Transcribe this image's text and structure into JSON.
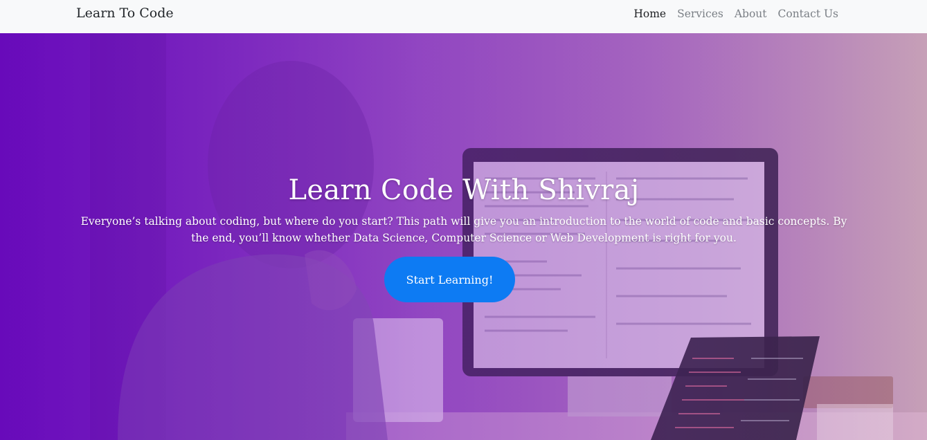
{
  "navbar": {
    "brand": "Learn To Code",
    "links": [
      {
        "label": "Home",
        "active": true
      },
      {
        "label": "Services",
        "active": false
      },
      {
        "label": "About",
        "active": false
      },
      {
        "label": "Contact Us",
        "active": false
      }
    ]
  },
  "hero": {
    "title": "Learn Code With Shivraj",
    "description": "Everyone’s talking about coding, but where do you start? This path will give you an introduction to the world of code and basic concepts. By the end, you’ll know whether Data Science, Computer Science or Web Development is right for you.",
    "cta_label": "Start Learning!"
  },
  "colors": {
    "navbar_bg": "#f8f9fa",
    "hero_overlay": "#6a0dbb",
    "cta_bg": "#0d7bf3"
  }
}
